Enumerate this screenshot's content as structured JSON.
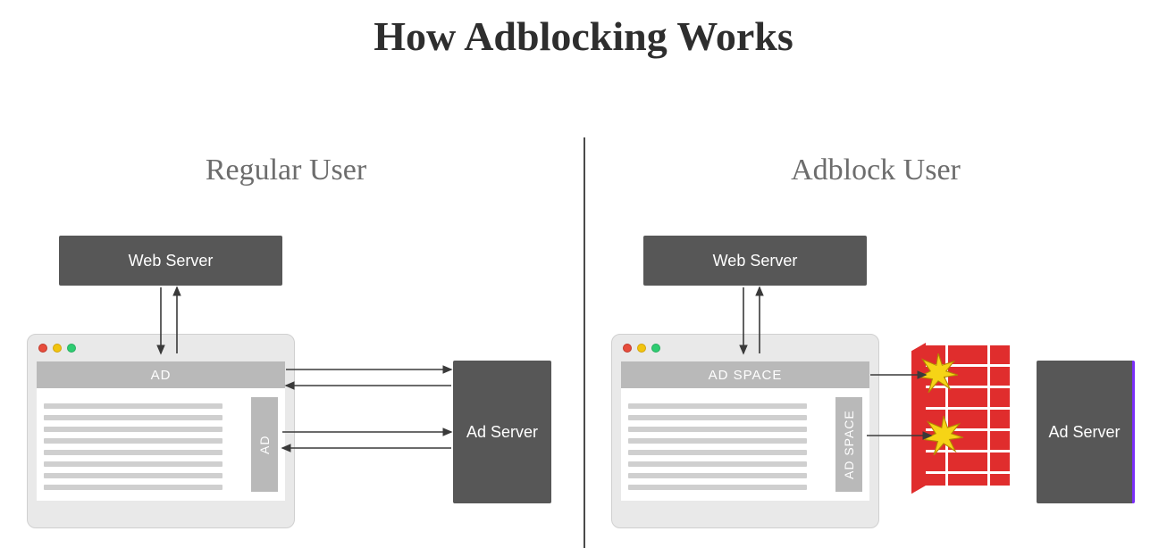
{
  "title": "How Adblocking Works",
  "panels": {
    "left": {
      "subtitle": "Regular User",
      "web_server_label": "Web Server",
      "ad_server_label": "Ad Server",
      "browser": {
        "banner_label": "AD",
        "side_label": "AD"
      }
    },
    "right": {
      "subtitle": "Adblock User",
      "web_server_label": "Web Server",
      "ad_server_label": "Ad Server",
      "browser": {
        "banner_label": "AD SPACE",
        "side_label": "AD SPACE"
      }
    }
  },
  "colors": {
    "server_bg": "#575757",
    "browser_bg": "#e9e9e9",
    "ad_bg": "#b9b9b9",
    "wall": "#e02d2d",
    "spark": "#f1c40f"
  }
}
